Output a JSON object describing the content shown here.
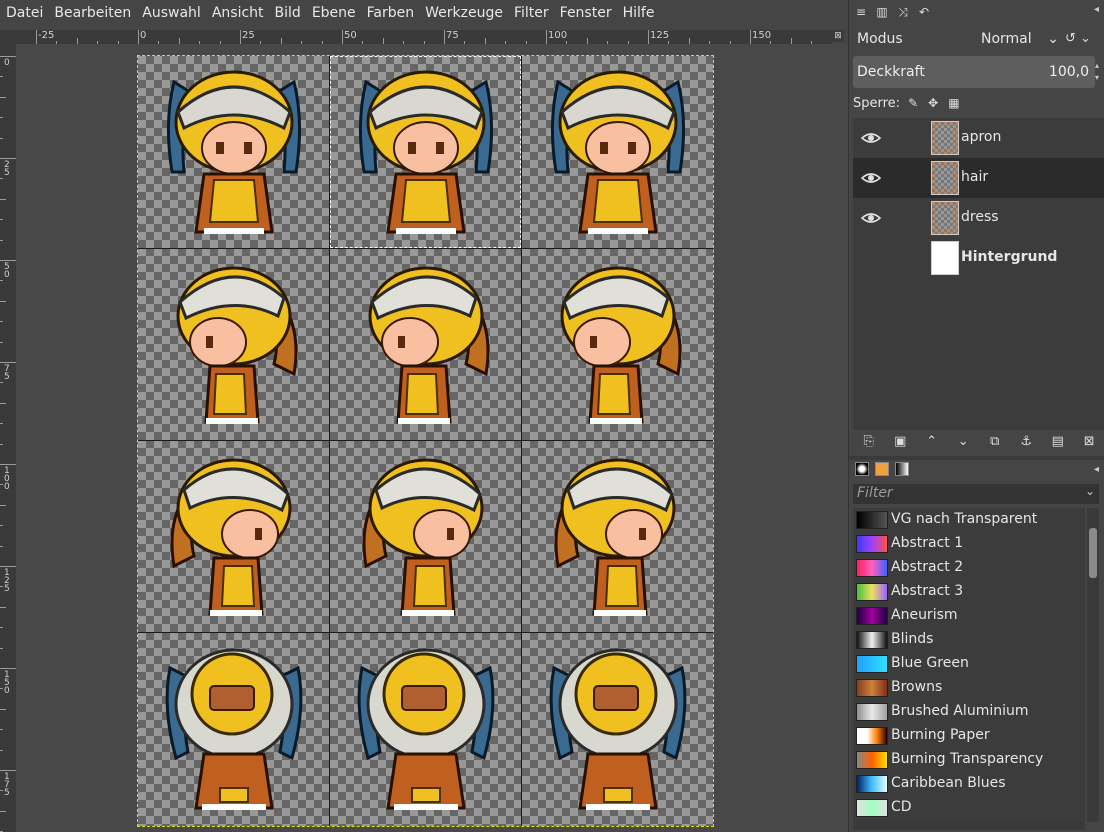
{
  "menubar": {
    "items": [
      "Datei",
      "Bearbeiten",
      "Auswahl",
      "Ansicht",
      "Bild",
      "Ebene",
      "Farben",
      "Werkzeuge",
      "Filter",
      "Fenster",
      "Hilfe"
    ]
  },
  "rulers": {
    "horizontal_labels": [
      "-25",
      "0",
      "25",
      "50",
      "75",
      "100",
      "125",
      "150"
    ],
    "vertical_labels": [
      "0",
      "25",
      "50",
      "75",
      "100",
      "125",
      "150",
      "175"
    ]
  },
  "layers_panel": {
    "mode_label": "Modus",
    "mode_value": "Normal",
    "opacity_label": "Deckkraft",
    "opacity_value": "100,0",
    "lock_label": "Sperre:",
    "layers": [
      {
        "name": "apron",
        "visible": true,
        "selected": false
      },
      {
        "name": "hair",
        "visible": true,
        "selected": true
      },
      {
        "name": "dress",
        "visible": true,
        "selected": false
      },
      {
        "name": "Hintergrund",
        "visible": false,
        "selected": false
      }
    ]
  },
  "gradients_panel": {
    "filter_placeholder": "Filter",
    "items": [
      {
        "name": "VG nach Transparent",
        "colors": [
          "#000000",
          "#555555"
        ]
      },
      {
        "name": "Abstract 1",
        "colors": [
          "#3b3bff",
          "#a040ff",
          "#ff5050"
        ]
      },
      {
        "name": "Abstract 2",
        "colors": [
          "#ff2060",
          "#ff60c0",
          "#4060ff"
        ]
      },
      {
        "name": "Abstract 3",
        "colors": [
          "#40c040",
          "#f0e060",
          "#a060ff"
        ]
      },
      {
        "name": "Aneurism",
        "colors": [
          "#200040",
          "#a000a0",
          "#200040"
        ]
      },
      {
        "name": "Blinds",
        "colors": [
          "#101010",
          "#f0f0f0",
          "#101010"
        ]
      },
      {
        "name": "Blue Green",
        "colors": [
          "#20a0ff",
          "#30e0ff"
        ]
      },
      {
        "name": "Browns",
        "colors": [
          "#804020",
          "#d08040",
          "#803010"
        ]
      },
      {
        "name": "Brushed Aluminium",
        "colors": [
          "#909090",
          "#e8e8e8",
          "#a0a0a0"
        ]
      },
      {
        "name": "Burning Paper",
        "colors": [
          "#ffffff",
          "#ffffff",
          "#ff8000",
          "#200000"
        ]
      },
      {
        "name": "Burning Transparency",
        "colors": [
          "#888888",
          "#ff6000",
          "#ffe000"
        ]
      },
      {
        "name": "Caribbean Blues",
        "colors": [
          "#002060",
          "#40c0ff",
          "#e0ffff"
        ]
      },
      {
        "name": "CD",
        "colors": [
          "#e0e0e0",
          "#a0ffc0",
          "#e0e0e0"
        ]
      }
    ]
  }
}
